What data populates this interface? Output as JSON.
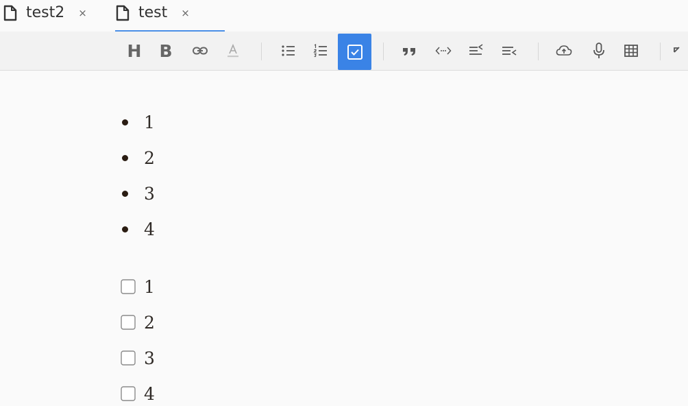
{
  "tabs": [
    {
      "label": "test2",
      "close": "×",
      "active": false
    },
    {
      "label": "test",
      "close": "×",
      "active": true
    }
  ],
  "toolbar": {
    "heading": "H",
    "bold": "B",
    "icons": [
      "heading-icon",
      "bold-icon",
      "link-icon",
      "text-color-icon",
      "bullet-list-icon",
      "numbered-list-icon",
      "checklist-icon",
      "quote-icon",
      "code-icon",
      "outdent-icon",
      "indent-icon",
      "upload-icon",
      "microphone-icon",
      "table-icon",
      "undo-icon"
    ],
    "accent_color": "#3a83e6"
  },
  "editor": {
    "bullet_list": [
      "1",
      "2",
      "3",
      "4"
    ],
    "check_list": [
      {
        "text": "1",
        "checked": false
      },
      {
        "text": "2",
        "checked": false
      },
      {
        "text": "3",
        "checked": false
      },
      {
        "text": "4",
        "checked": false
      }
    ]
  }
}
